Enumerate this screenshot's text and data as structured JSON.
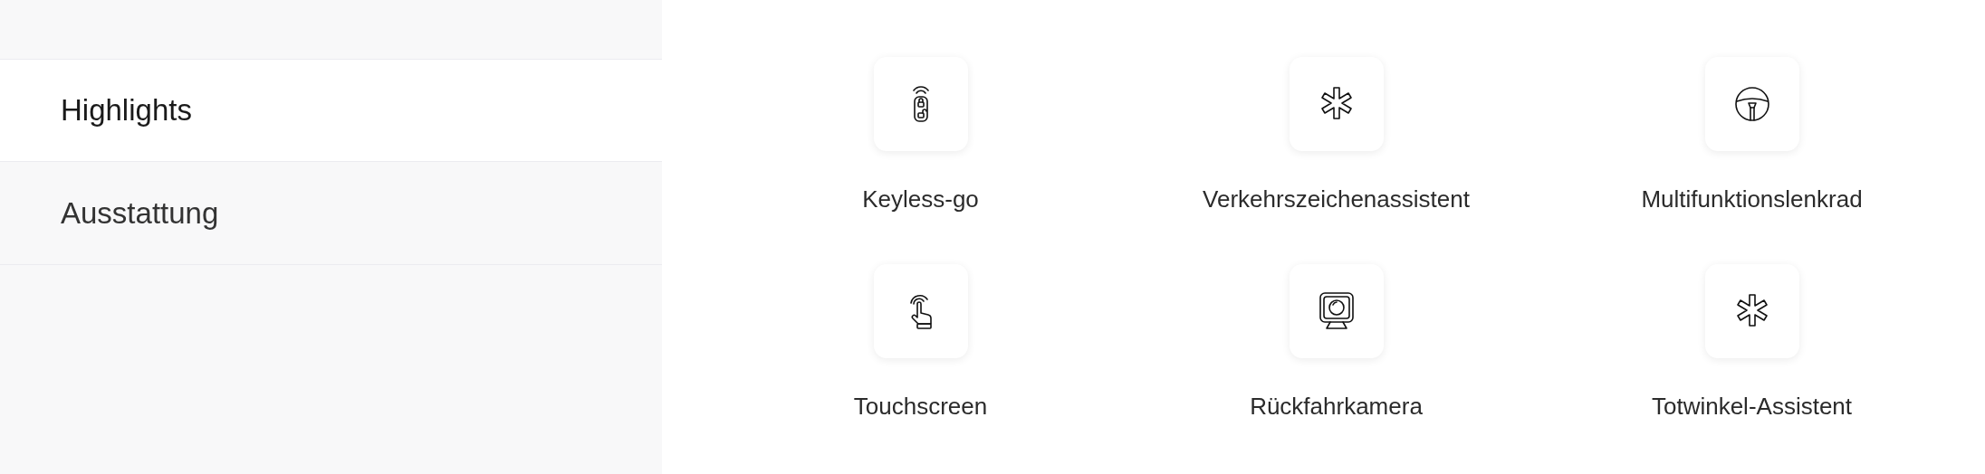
{
  "sidebar": {
    "items": [
      {
        "label": "Highlights",
        "selected": true
      },
      {
        "label": "Ausstattung",
        "selected": false
      }
    ]
  },
  "features": [
    {
      "label": "Keyless-go",
      "kind": "keyfob"
    },
    {
      "label": "Verkehrszeichenassistent",
      "kind": "asterisk"
    },
    {
      "label": "Multifunktionslenkrad",
      "kind": "wheel"
    },
    {
      "label": "Touchscreen",
      "kind": "touch"
    },
    {
      "label": "Rückfahrkamera",
      "kind": "camera"
    },
    {
      "label": "Totwinkel-Assistent",
      "kind": "asterisk"
    }
  ]
}
